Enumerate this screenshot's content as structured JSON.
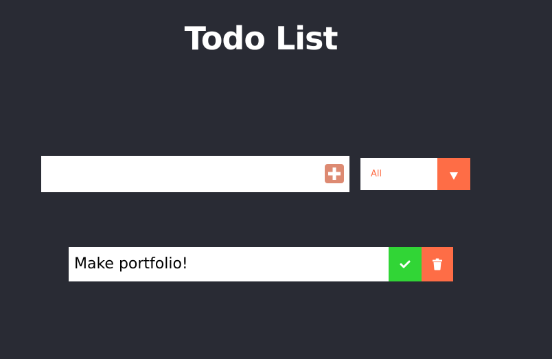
{
  "page": {
    "title": "Todo List"
  },
  "form": {
    "input_value": "",
    "input_placeholder": "",
    "add_icon": "plus-square-icon"
  },
  "filter": {
    "selected": "All",
    "arrow_icon": "caret-down-icon"
  },
  "todos": [
    {
      "text": "Make portfolio!",
      "completed": false,
      "complete_icon": "check-icon",
      "delete_icon": "trash-icon"
    }
  ],
  "colors": {
    "background": "#292b34",
    "accent": "#fe6d46",
    "add_button": "#dd8a72",
    "complete": "#31d536",
    "text": "#ffffff"
  }
}
